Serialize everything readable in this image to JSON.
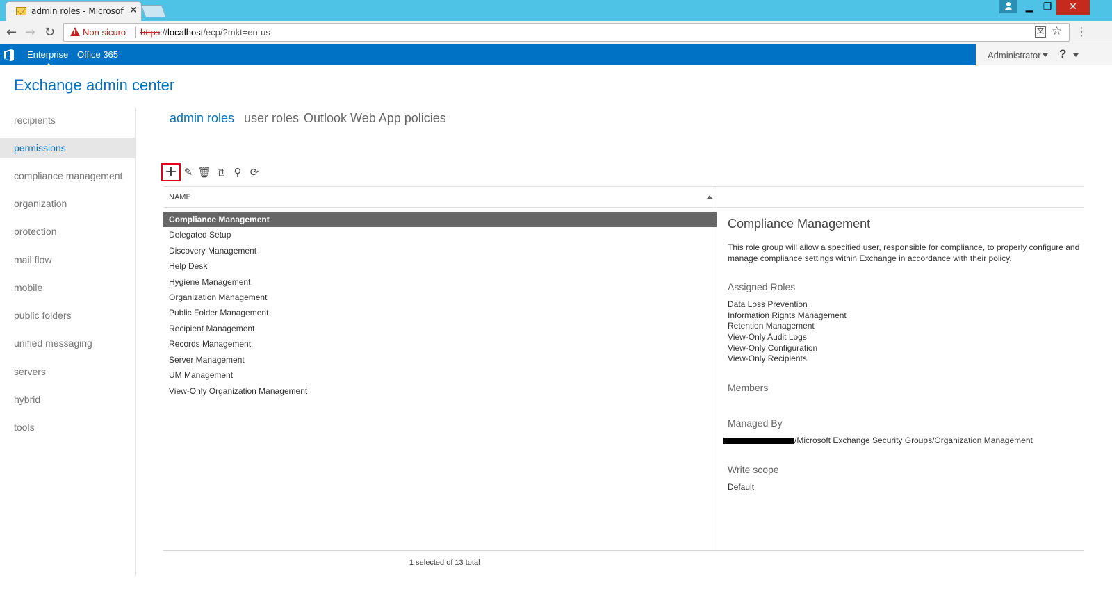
{
  "browser": {
    "tab_title": "admin roles - Microsoft Exchange",
    "tab_close": "✕",
    "security_label": "Non sicuro",
    "url_scheme": "https",
    "url_sep": "://",
    "url_host": "localhost",
    "url_path": "/ecp/?mkt=en-us",
    "back_glyph": "←",
    "forward_glyph": "→",
    "reload_glyph": "↻",
    "star_glyph": "☆",
    "menu_glyph": "⋮",
    "translate_glyph": "文",
    "win_min": "▁",
    "win_max": "❐",
    "win_close": "✕"
  },
  "header": {
    "links": [
      "Enterprise",
      "Office 365"
    ],
    "admin_name": "Administrator",
    "help_glyph": "?"
  },
  "app": {
    "title": "Exchange admin center"
  },
  "leftnav": {
    "items": [
      "recipients",
      "permissions",
      "compliance management",
      "organization",
      "protection",
      "mail flow",
      "mobile",
      "public folders",
      "unified messaging",
      "servers",
      "hybrid",
      "tools"
    ],
    "active_index": 1
  },
  "subtabs": [
    "admin roles",
    "user roles",
    "Outlook Web App policies"
  ],
  "toolbar": {
    "icons": [
      "add-icon",
      "edit-icon",
      "delete-icon",
      "copy-icon",
      "search-icon",
      "refresh-icon"
    ],
    "glyphs": [
      "+",
      "✎",
      "🗑",
      "⧉",
      "⚲",
      "⟳"
    ]
  },
  "grid": {
    "column": "NAME",
    "rows": [
      "Compliance Management",
      "Delegated Setup",
      "Discovery Management",
      "Help Desk",
      "Hygiene Management",
      "Organization Management",
      "Public Folder Management",
      "Recipient Management",
      "Records Management",
      "Server Management",
      "UM Management",
      "View-Only Organization Management"
    ],
    "selected_index": 0,
    "status": "1 selected of 13 total"
  },
  "details": {
    "title": "Compliance Management",
    "description": "This role group will allow a specified user, responsible for compliance, to properly configure and manage compliance settings within Exchange in accordance with their policy.",
    "assigned_roles_label": "Assigned Roles",
    "assigned_roles": [
      "Data Loss Prevention",
      "Information Rights Management",
      "Retention Management",
      "View-Only Audit Logs",
      "View-Only Configuration",
      "View-Only Recipients"
    ],
    "members_label": "Members",
    "managed_by_label": "Managed By",
    "managed_by": "/Microsoft Exchange Security Groups/Organization Management",
    "write_scope_label": "Write scope",
    "write_scope": "Default"
  },
  "colors": {
    "accent": "#0072c6",
    "selected_row": "#666666",
    "highlight_border": "#e3001b"
  }
}
